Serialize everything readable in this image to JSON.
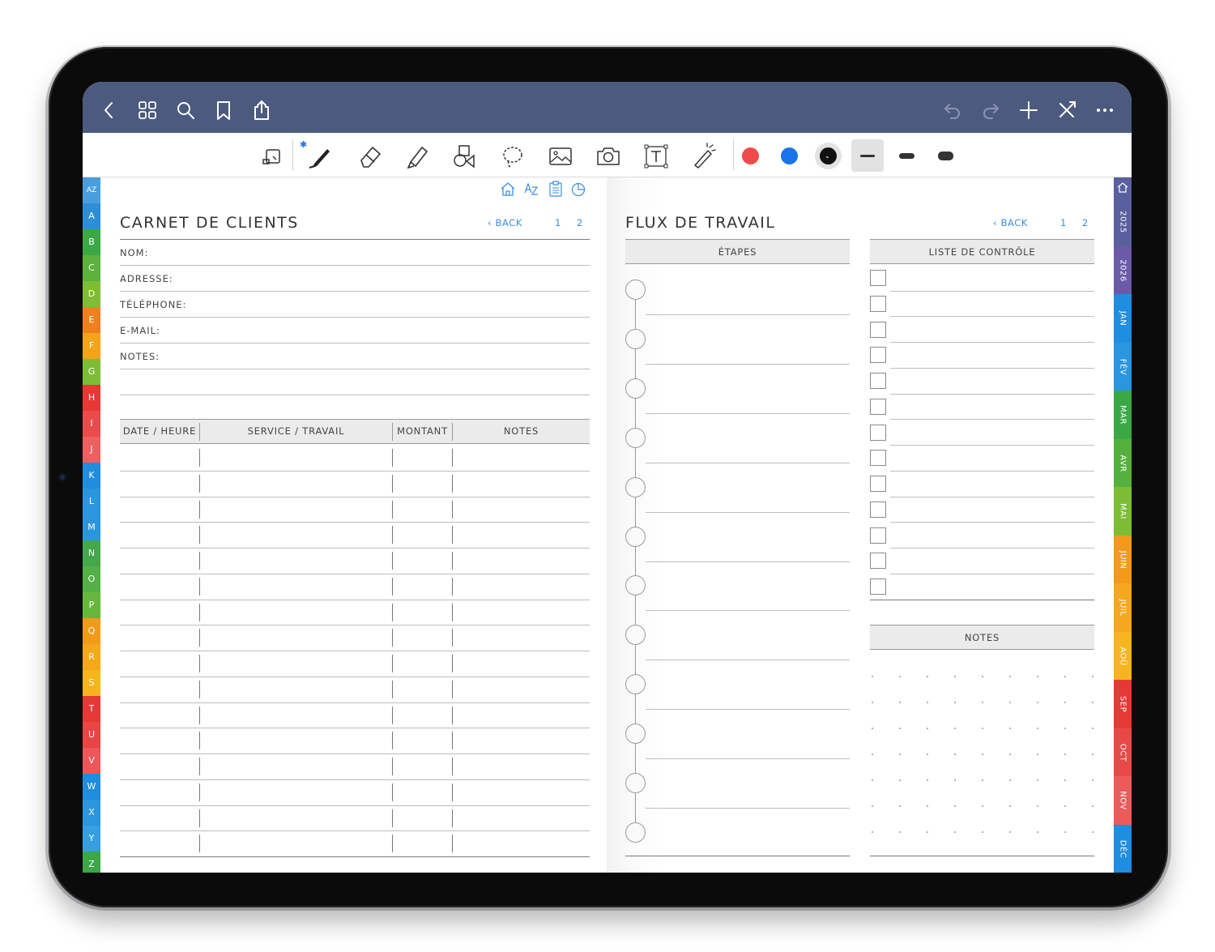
{
  "topbar": {
    "left_icons": [
      "back-chevron-icon",
      "grid-icon",
      "search-icon",
      "bookmark-icon",
      "share-icon"
    ],
    "right_icons": [
      "undo-icon",
      "redo-icon",
      "plus-icon",
      "close-collapse-icon",
      "more-icon"
    ]
  },
  "toolbar": {
    "tools": [
      "read-mode-icon",
      "pen-icon",
      "eraser-icon",
      "highlighter-icon",
      "shapes-icon",
      "lasso-icon",
      "image-icon",
      "camera-icon",
      "text-icon",
      "laser-pointer-icon"
    ],
    "colors": [
      "#ef4b4b",
      "#1a73e8",
      "#111111"
    ],
    "selected_color": "#111111",
    "thickness_options": [
      "thin",
      "medium",
      "thick"
    ],
    "selected_thickness": "thin"
  },
  "left_page": {
    "top_icons": [
      "home-icon",
      "az-index-icon",
      "clipboard-icon",
      "pie-chart-icon"
    ],
    "title": "CARNET DE CLIENTS",
    "back_label": "BACK",
    "page_links": [
      "1",
      "2"
    ],
    "fields": [
      "NOM:",
      "ADRESSE:",
      "TÉLÉPHONE:",
      "E-MAIL:",
      "NOTES:"
    ],
    "table": {
      "columns": [
        "DATE / HEURE",
        "SERVICE / TRAVAIL",
        "MONTANT",
        "NOTES"
      ],
      "row_count": 16
    }
  },
  "right_page": {
    "title": "FLUX DE TRAVAIL",
    "back_label": "BACK",
    "page_links": [
      "1",
      "2"
    ],
    "steps_header": "ÉTAPES",
    "step_count": 12,
    "checklist_header": "LISTE DE CONTRÔLE",
    "checklist_count": 13,
    "notes_header": "NOTES"
  },
  "alpha_tabs": [
    {
      "label": "AZ",
      "color": "#2a8fd8"
    },
    {
      "label": "A",
      "color": "#2a8fd8"
    },
    {
      "label": "B",
      "color": "#3aa845"
    },
    {
      "label": "C",
      "color": "#5bb33c"
    },
    {
      "label": "D",
      "color": "#7fbd34"
    },
    {
      "label": "E",
      "color": "#f07f1e"
    },
    {
      "label": "F",
      "color": "#f5a31a"
    },
    {
      "label": "G",
      "color": "#7cbd33"
    },
    {
      "label": "H",
      "color": "#e53935"
    },
    {
      "label": "I",
      "color": "#ea4b4b"
    },
    {
      "label": "J",
      "color": "#ee6060"
    },
    {
      "label": "K",
      "color": "#1f8de0"
    },
    {
      "label": "L",
      "color": "#2a96e0"
    },
    {
      "label": "M",
      "color": "#2a96e0"
    },
    {
      "label": "N",
      "color": "#43a84a"
    },
    {
      "label": "O",
      "color": "#52b045"
    },
    {
      "label": "P",
      "color": "#66b83d"
    },
    {
      "label": "Q",
      "color": "#f39a1a"
    },
    {
      "label": "R",
      "color": "#f5a81c"
    },
    {
      "label": "S",
      "color": "#f6b41e"
    },
    {
      "label": "T",
      "color": "#e53935"
    },
    {
      "label": "U",
      "color": "#e94545"
    },
    {
      "label": "V",
      "color": "#ee5757"
    },
    {
      "label": "W",
      "color": "#1f8de0"
    },
    {
      "label": "X",
      "color": "#2a96e0"
    },
    {
      "label": "Y",
      "color": "#34a0e2"
    },
    {
      "label": "Z",
      "color": "#3aa845"
    }
  ],
  "month_tabs": [
    {
      "label": "2025",
      "color": "#5a5f9e"
    },
    {
      "label": "2026",
      "color": "#6a5aa8"
    },
    {
      "label": "JAN",
      "color": "#1f8de0"
    },
    {
      "label": "FÉV",
      "color": "#2a96e0"
    },
    {
      "label": "MAR",
      "color": "#3aa845"
    },
    {
      "label": "AVR",
      "color": "#55b13e"
    },
    {
      "label": "MAI",
      "color": "#7cbd33"
    },
    {
      "label": "JUIN",
      "color": "#f39a1a"
    },
    {
      "label": "JUIL",
      "color": "#f5a81c"
    },
    {
      "label": "AOÛ",
      "color": "#f6b41e"
    },
    {
      "label": "SEP",
      "color": "#e53935"
    },
    {
      "label": "OCT",
      "color": "#ea4848"
    },
    {
      "label": "NOV",
      "color": "#ee5a5a"
    },
    {
      "label": "DÉC",
      "color": "#1f8de0"
    }
  ]
}
